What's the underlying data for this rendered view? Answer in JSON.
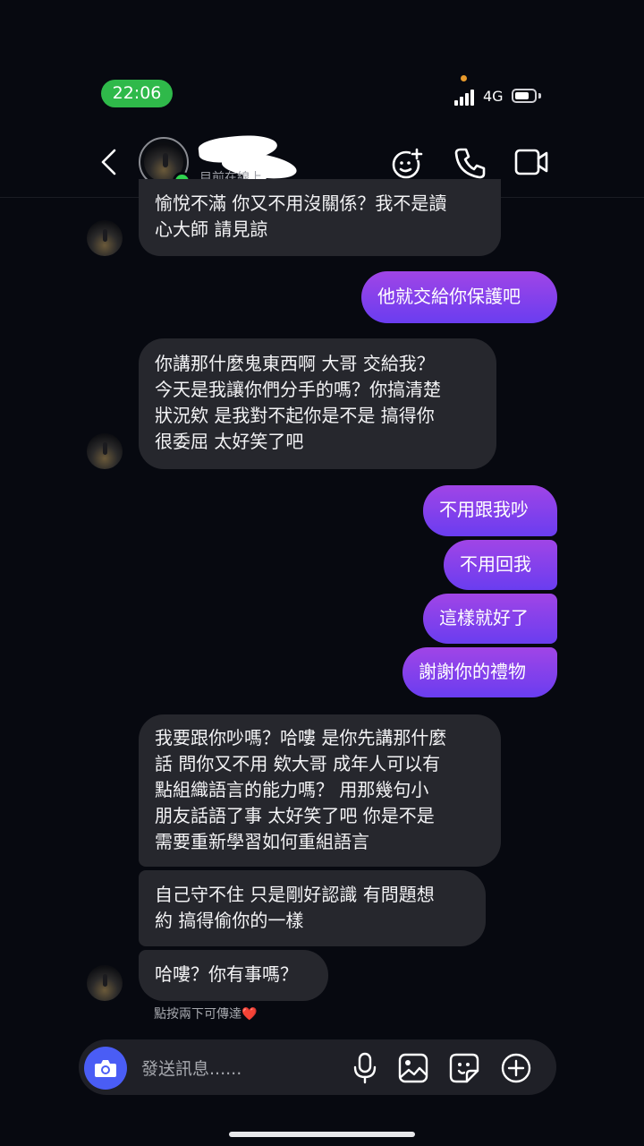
{
  "status_bar": {
    "time": "22:06",
    "network": "4G",
    "battery_percent": 75
  },
  "header": {
    "status_text": "目前在線上"
  },
  "messages": [
    {
      "text": "愉悅不滿 你又不用沒關係？我不是讀\n心大師 請見諒"
    },
    {
      "text": "他就交給你保護吧"
    },
    {
      "text": "你講那什麼鬼東西啊 大哥 交給我？\n今天是我讓你們分手的嗎？你搞清楚\n狀況欸 是我對不起你是不是 搞得你\n很委屈 太好笑了吧"
    },
    {
      "text": "不用跟我吵"
    },
    {
      "text": "不用回我"
    },
    {
      "text": "這樣就好了"
    },
    {
      "text": "謝謝你的禮物"
    },
    {
      "text": "我要跟你吵嗎？哈嘍 是你先講那什麼\n話 問你又不用 欸大哥 成年人可以有\n點組織語言的能力嗎？ 用那幾句小\n朋友話語了事 太好笑了吧 你是不是\n需要重新學習如何重組語言"
    },
    {
      "text": "自己守不住 只是剛好認識 有問題想\n約 搞得偷你的一樣"
    },
    {
      "text": "哈嘍？你有事嗎？"
    }
  ],
  "hint": {
    "text": "點按兩下可傳達",
    "emoji": "❤️"
  },
  "composer": {
    "placeholder": "發送訊息......"
  },
  "colors": {
    "purple_top": "#a045e6",
    "purple_bottom": "#6a3df0",
    "incoming": "#26272d",
    "online": "#2fd54f",
    "camera": "#4a5df5"
  }
}
